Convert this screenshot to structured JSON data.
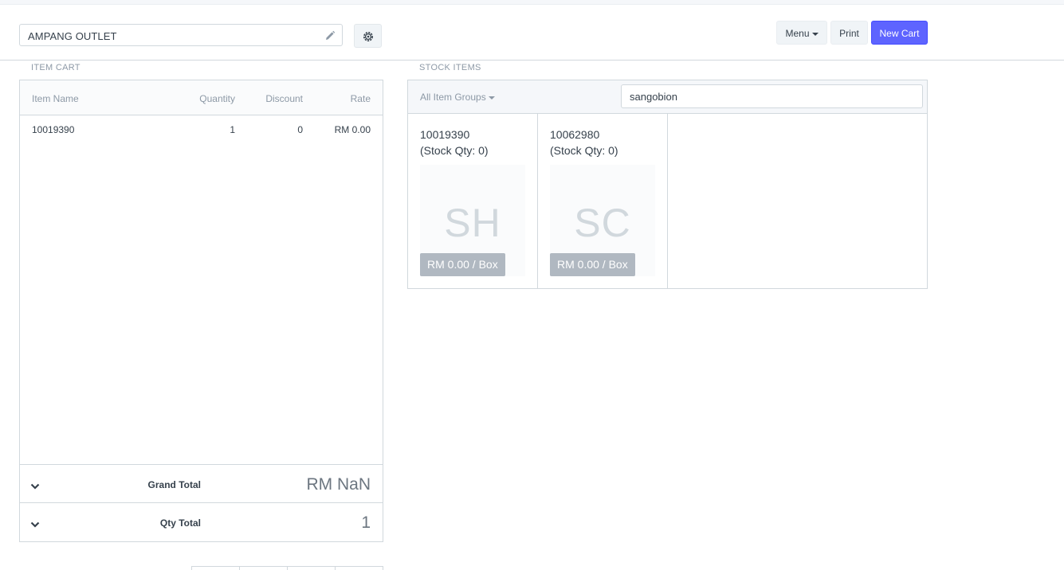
{
  "customer": {
    "value": "AMPANG OUTLET"
  },
  "toolbar": {
    "menu_label": "Menu",
    "print_label": "Print",
    "new_cart_label": "New Cart"
  },
  "cart": {
    "section_label": "ITEM CART",
    "columns": {
      "name": "Item Name",
      "quantity": "Quantity",
      "discount": "Discount",
      "rate": "Rate"
    },
    "rows": [
      {
        "name": "10019390",
        "quantity": "1",
        "discount": "0",
        "rate": "RM 0.00"
      }
    ],
    "grand_total_label": "Grand Total",
    "grand_total_value": "RM NaN",
    "qty_total_label": "Qty Total",
    "qty_total_value": "1"
  },
  "stock": {
    "section_label": "STOCK ITEMS",
    "group_filter": "All Item Groups",
    "search_value": "sangobion",
    "items": [
      {
        "code": "10019390",
        "qty_text": "(Stock Qty: 0)",
        "abbr": "SH",
        "price": "RM 0.00 / Box"
      },
      {
        "code": "10062980",
        "qty_text": "(Stock Qty: 0)",
        "abbr": "SC",
        "price": "RM 0.00 / Box"
      }
    ]
  },
  "colors": {
    "primary": "#5e64ff",
    "border": "#d1d8dd",
    "muted_text": "#8d99a6",
    "price_badge": "#b0b8c1"
  },
  "icons": {
    "edit": "pencil-icon",
    "settings": "gear-icon",
    "collapse": "chevron-down-icon"
  }
}
